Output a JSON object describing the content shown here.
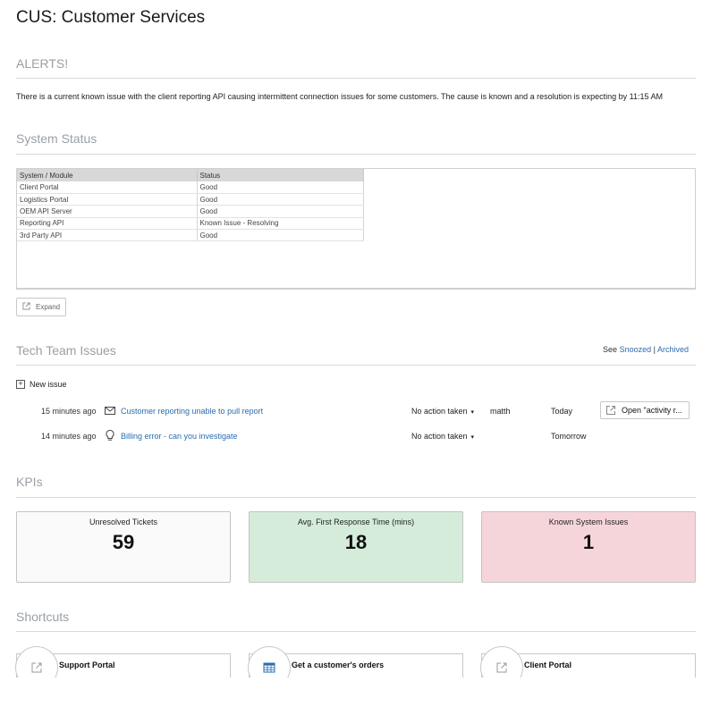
{
  "page": {
    "title": "CUS: Customer Services"
  },
  "alerts": {
    "heading": "ALERTS!",
    "text": "There is a current known issue with the client reporting API causing intermittent connection issues for some customers. The cause is known and a resolution is expecting by 11:15 AM"
  },
  "system_status": {
    "heading": "System Status",
    "columns": [
      "System / Module",
      "Status"
    ],
    "rows": [
      [
        "Client Portal",
        "Good"
      ],
      [
        "Logistics Portal",
        "Good"
      ],
      [
        "OEM API Server",
        "Good"
      ],
      [
        "Reporting API",
        "Known Issue - Resolving"
      ],
      [
        "3rd Party API",
        "Good"
      ]
    ],
    "expand_label": "Expand"
  },
  "tech_issues": {
    "heading": "Tech Team Issues",
    "see_label": "See",
    "snoozed_label": "Snoozed",
    "separator": "|",
    "archived_label": "Archived",
    "new_issue_label": "New issue",
    "issues": [
      {
        "time": "15 minutes ago",
        "icon": "envelope-icon",
        "title": "Customer reporting unable to pull report",
        "action": "No action taken",
        "user": "matth",
        "due": "Today",
        "open_label": "Open \"activity r..."
      },
      {
        "time": "14 minutes ago",
        "icon": "lightbulb-icon",
        "title": "Billing error - can you investigate",
        "action": "No action taken",
        "user": "",
        "due": "Tomorrow"
      }
    ]
  },
  "kpis": {
    "heading": "KPIs",
    "items": [
      {
        "label": "Unresolved Tickets",
        "value": "59",
        "color": "#fafafa"
      },
      {
        "label": "Avg. First Response Time (mins)",
        "value": "18",
        "color": "#d5ecdb"
      },
      {
        "label": "Known System Issues",
        "value": "1",
        "color": "#f6d5da"
      }
    ]
  },
  "shortcuts": {
    "heading": "Shortcuts",
    "items": [
      {
        "label": "Support Portal",
        "icon": "external-link-icon"
      },
      {
        "label": "Get a customer's orders",
        "icon": "table-icon"
      },
      {
        "label": "Client Portal",
        "icon": "external-link-icon"
      }
    ]
  },
  "colors": {
    "link": "#2a6db0",
    "section_heading": "#9aa0a6"
  }
}
